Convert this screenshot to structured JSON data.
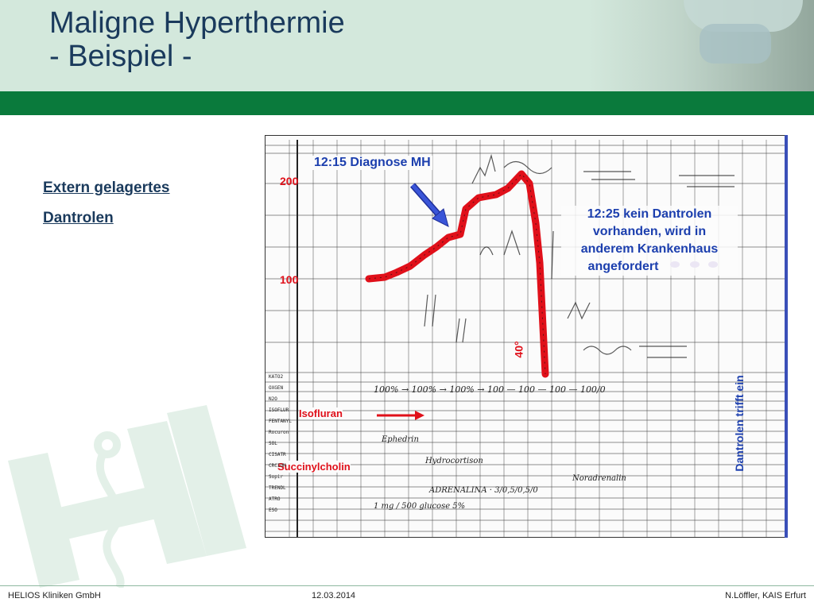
{
  "slide": {
    "title_line1": "Maligne Hyperthermie",
    "title_line2": "- Beispiel -",
    "bullet_line1": "Extern gelagertes",
    "bullet_line2": "Dantrolen"
  },
  "chart": {
    "annotation_diagnose": "12:15 Diagnose MH",
    "annotation_kein_dantrolen": [
      "12:25 kein Dantrolen",
      "vorhanden, wird in",
      "anderem Krankenhaus",
      "angefordert"
    ],
    "axis_200": "200",
    "axis_100": "100",
    "label_40": "40°",
    "label_isofluran": "Isofluran",
    "label_succinylcholin": "Succinylcholin",
    "label_dantrolen_trifft": "Dantrolen trifft ein",
    "row_labels": [
      "KATO2",
      "OXGEN",
      "N2O",
      "ISOFLUR",
      "FENTANYL",
      "Rocuron",
      "SOL",
      "CISATR",
      "CRCIUM",
      "Sopir TRENDL",
      "ATRO",
      "ESO"
    ],
    "handwritten_rows": [
      "100% → 100% → 100% → 100 — 100 — 100 — 100/0",
      "Ephedrin",
      "Hydrocortison",
      "Noradrenalin",
      "ADRENALINA · 3/0,5/0,5/0",
      "1 mg / 500 glucose 5%"
    ],
    "colors": {
      "trace": "#e0101a",
      "annotation": "#1c3fae",
      "arrow_blue": "#3a55d8",
      "label_red": "#e0101a"
    }
  },
  "footer": {
    "company": "HELIOS Kliniken GmbH",
    "date": "12.03.2014",
    "author": "N.Löffler,  KAIS Erfurt"
  }
}
